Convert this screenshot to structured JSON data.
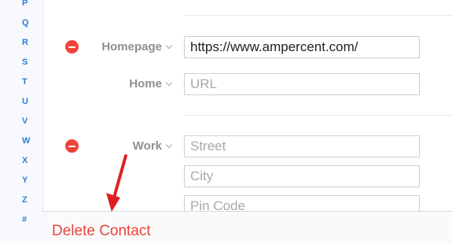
{
  "index_letters": [
    "P",
    "Q",
    "R",
    "S",
    "T",
    "U",
    "V",
    "W",
    "X",
    "Y",
    "Z",
    "#"
  ],
  "fields": {
    "homepage": {
      "label": "Homepage",
      "value": "https://www.ampercent.com/"
    },
    "home_url": {
      "label": "Home",
      "placeholder": "URL"
    },
    "work_address": {
      "label": "Work",
      "street_placeholder": "Street",
      "city_placeholder": "City",
      "pin_placeholder": "Pin Code"
    }
  },
  "footer": {
    "delete_label": "Delete Contact"
  },
  "colors": {
    "accent_blue": "#2d7fd3",
    "remove_red": "#f0443a",
    "delete_red": "#e5453b",
    "annotation_arrow": "#e02020"
  },
  "icons": {
    "remove": "minus-circle-icon",
    "dropdown": "chevron-down-icon",
    "annotation": "red-arrow-icon"
  }
}
